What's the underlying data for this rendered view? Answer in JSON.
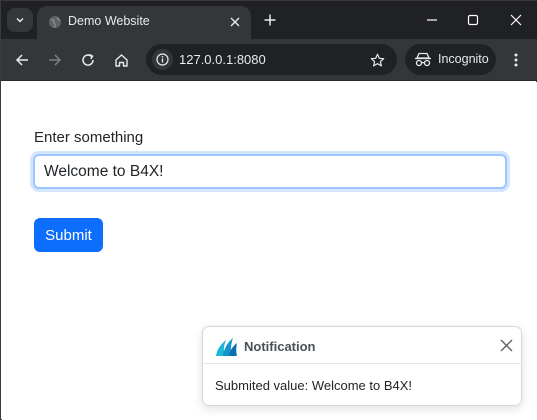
{
  "browser": {
    "tab": {
      "title": "Demo Website"
    },
    "address_bar": {
      "url": "127.0.0.1:8080"
    },
    "profile": {
      "label": "Incognito"
    }
  },
  "page": {
    "form": {
      "label": "Enter something",
      "input_value": "Welcome to B4X!",
      "submit_label": "Submit"
    },
    "toast": {
      "title": "Notification",
      "message": "Submited value: Welcome to B4X!"
    }
  },
  "colors": {
    "primary": "#0d6efd",
    "input_focus_border": "#9ec5fe",
    "chrome_dark": "#202124",
    "chrome_toolbar": "#35363a"
  }
}
